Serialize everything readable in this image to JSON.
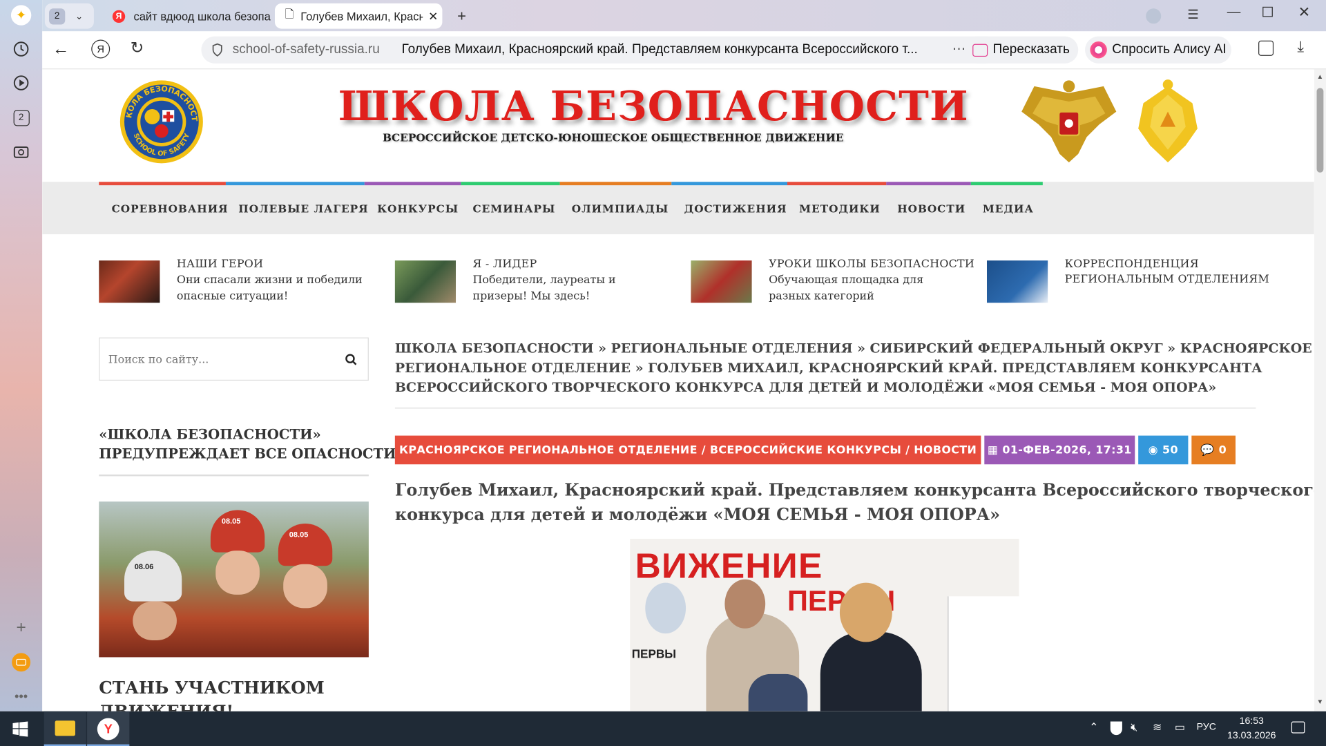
{
  "browser": {
    "tab_count": "2",
    "tabs": [
      {
        "title": "сайт вдюод школа безопа"
      },
      {
        "title": "Голубев Михаил, Красн"
      }
    ],
    "url_domain": "school-of-safety-russia.ru",
    "page_title": "Голубев Михаил, Красноярский край. Представляем конкурсанта Всероссийского т...",
    "retell_label": "Пересказать",
    "alice_label": "Спросить Алису AI"
  },
  "header": {
    "logo_ring_top": "ШКОЛА БЕЗОПАСНОСТИ",
    "logo_ring_bottom": "SCHOOL OF SAFETY",
    "title": "ШКОЛА БЕЗОПАСНОСТИ",
    "subtitle": "ВСЕРОССИЙСКОЕ ДЕТСКО-ЮНОШЕСКОЕ ОБЩЕСТВЕННОЕ ДВИЖЕНИЕ"
  },
  "nav": {
    "items": [
      "СОРЕВНОВАНИЯ",
      "ПОЛЕВЫЕ ЛАГЕРЯ",
      "КОНКУРСЫ",
      "СЕМИНАРЫ",
      "ОЛИМПИАДЫ",
      "ДОСТИЖЕНИЯ",
      "МЕТОДИКИ",
      "НОВОСТИ",
      "МЕДИА"
    ],
    "colors": [
      "#e74c3c",
      "#3498db",
      "#9b59b6",
      "#2ecc71",
      "#e67e22",
      "#3498db",
      "#e74c3c",
      "#9b59b6",
      "#2ecc71"
    ]
  },
  "featured": [
    {
      "title": "НАШИ ГЕРОИ",
      "desc1": "Они спасали жизни и победили",
      "desc2": "опасные ситуации!"
    },
    {
      "title": "Я - ЛИДЕР",
      "desc1": "Победители, лауреаты и",
      "desc2": "призеры! Мы здесь!"
    },
    {
      "title": "УРОКИ ШКОЛЫ БЕЗОПАСНОСТИ",
      "desc1": "Обучающая площадка для",
      "desc2": "разных категорий"
    },
    {
      "title": "КОРРЕСПОНДЕНЦИЯ",
      "desc1": "РЕГИОНАЛЬНЫМ ОТДЕЛЕНИЯМ",
      "desc2": ""
    }
  ],
  "sidebar": {
    "search_placeholder": "Поиск по сайту...",
    "warn1": "«ШКОЛА БЕЗОПАСНОСТИ»",
    "warn2": "ПРЕДУПРЕЖДАЕТ ВСЕ ОПАСНОСТИ!",
    "join1": "СТАНЬ УЧАСТНИКОМ",
    "join2": "ДВИЖЕНИЯ!",
    "helmet_labels": [
      "08.05",
      "08.05",
      "08.06"
    ]
  },
  "breadcrumb": {
    "line1": "ШКОЛА БЕЗОПАСНОСТИ » РЕГИОНАЛЬНЫЕ ОТДЕЛЕНИЯ » СИБИРСКИЙ ФЕДЕРАЛЬНЫЙ ОКРУГ » КРАСНОЯРСКОЕ",
    "line2": "РЕГИОНАЛЬНОЕ ОТДЕЛЕНИЕ » ГОЛУБЕВ МИХАИЛ, КРАСНОЯРСКИЙ КРАЙ. ПРЕДСТАВЛЯЕМ КОНКУРСАНТА",
    "line3": "ВСЕРОССИЙСКОГО ТВОРЧЕСКОГО КОНКУРСА ДЛЯ ДЕТЕЙ И МОЛОДЁЖИ «МОЯ СЕМЬЯ - МОЯ ОПОРА»"
  },
  "article": {
    "categories": "КРАСНОЯРСКОЕ РЕГИОНАЛЬНОЕ ОТДЕЛЕНИЕ / ВСЕРОССИЙСКИЕ КОНКУРСЫ / НОВОСТИ",
    "date": "01-ФЕВ-2026, 17:31",
    "views": "50",
    "comments": "0",
    "title1": "Голубев Михаил, Красноярский край. Представляем конкурсанта Всероссийского творческого",
    "title2": "конкурса для детей и молодёжи «МОЯ СЕМЬЯ - МОЯ ОПОРА»",
    "photo_text1": "ВИЖЕНИЕ",
    "photo_text2": "ПЕРВЫ",
    "photo_text3": "ПЕРВЫ"
  },
  "taskbar": {
    "lang": "РУС",
    "time": "16:53",
    "date": "13.03.2026"
  }
}
